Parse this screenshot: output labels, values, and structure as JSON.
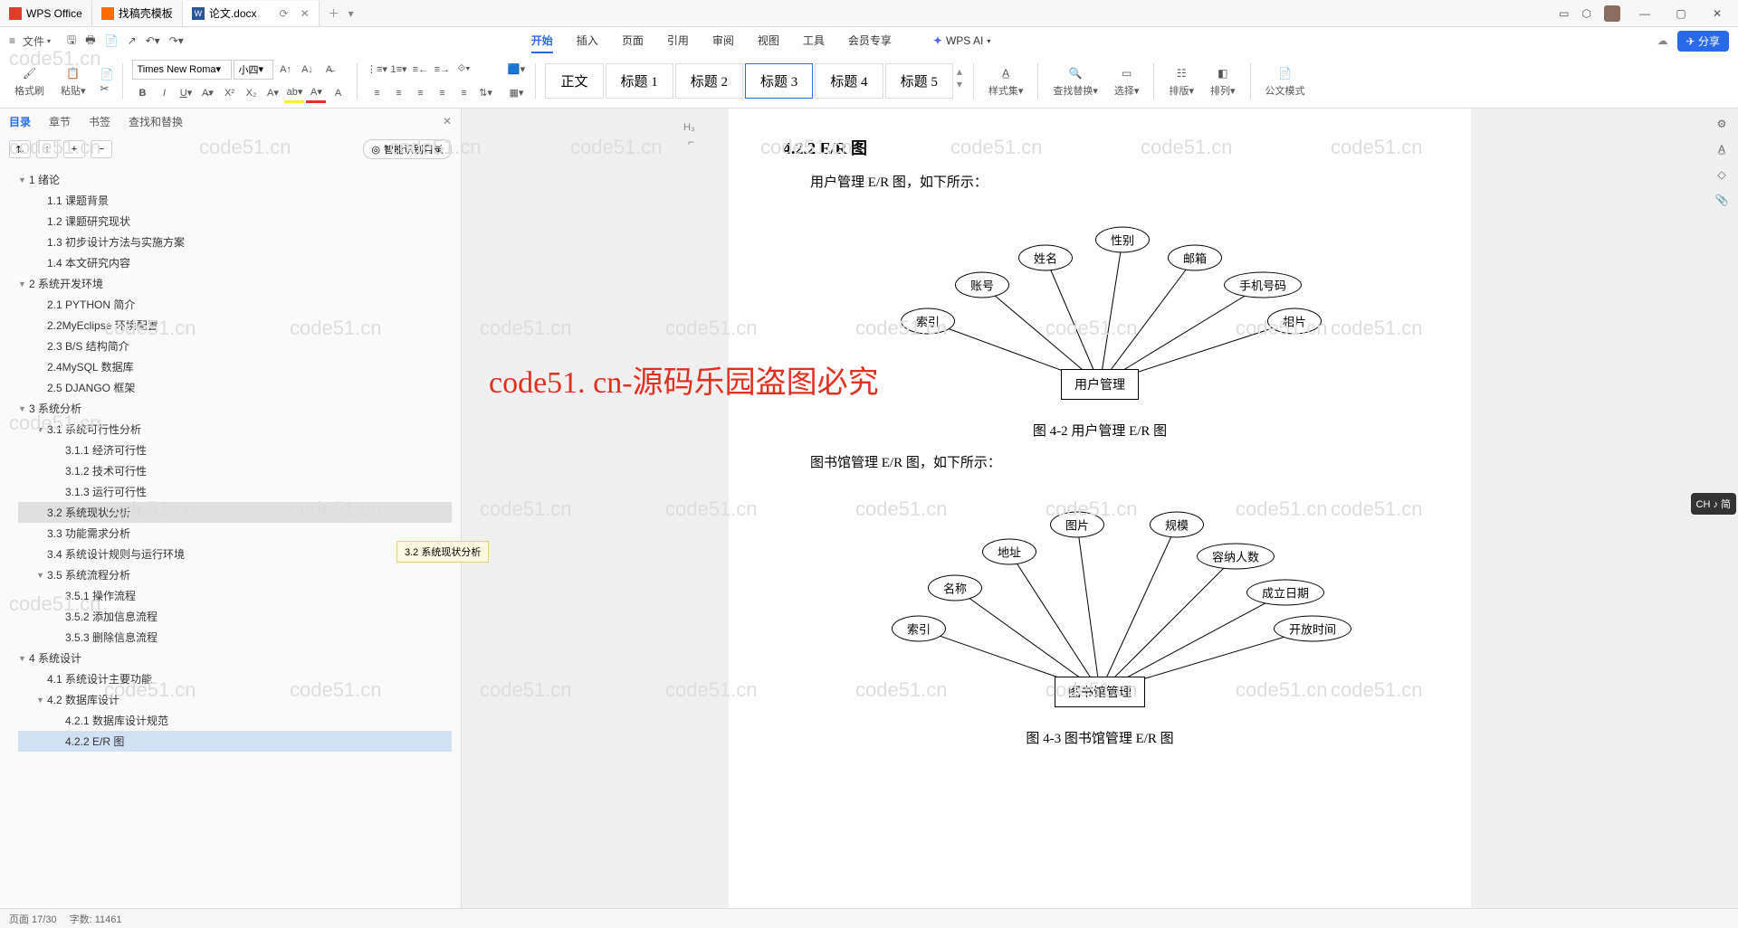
{
  "tabs": [
    {
      "icon": "W",
      "label": "WPS Office"
    },
    {
      "icon": "D",
      "label": "找稿壳模板"
    },
    {
      "icon": "W",
      "label": "论文.docx"
    }
  ],
  "menubar": {
    "file": "文件",
    "items": [
      "开始",
      "插入",
      "页面",
      "引用",
      "审阅",
      "视图",
      "工具",
      "会员专享"
    ],
    "active": "开始",
    "ai": "WPS AI",
    "share": "分享"
  },
  "ribbon": {
    "format_painter": "格式刷",
    "paste": "粘贴",
    "font_name": "Times New Roma",
    "font_size": "小四",
    "styles": [
      "正文",
      "标题 1",
      "标题 2",
      "标题 3",
      "标题 4",
      "标题 5"
    ],
    "style_active": "标题 3",
    "styleset": "样式集",
    "find_replace": "查找替换",
    "select": "选择",
    "layout_v": "排版",
    "layout_h": "排列",
    "gov_mode": "公文模式"
  },
  "sidebar": {
    "tabs": [
      "目录",
      "章节",
      "书签",
      "查找和替换"
    ],
    "active": "目录",
    "smart_toc": "智能识别目录",
    "tooltip": "3.2 系统现状分析",
    "toc": [
      {
        "l": 1,
        "t": "1 绪论",
        "c": true
      },
      {
        "l": 2,
        "t": "1.1 课题背景"
      },
      {
        "l": 2,
        "t": "1.2 课题研究现状"
      },
      {
        "l": 2,
        "t": "1.3 初步设计方法与实施方案"
      },
      {
        "l": 2,
        "t": "1.4 本文研究内容"
      },
      {
        "l": 1,
        "t": "2 系统开发环境",
        "c": true
      },
      {
        "l": 2,
        "t": "2.1 PYTHON 简介"
      },
      {
        "l": 2,
        "t": "2.2MyEclipse 环境配置"
      },
      {
        "l": 2,
        "t": "2.3 B/S 结构简介"
      },
      {
        "l": 2,
        "t": "2.4MySQL 数据库"
      },
      {
        "l": 2,
        "t": "2.5 DJANGO 框架"
      },
      {
        "l": 1,
        "t": "3 系统分析",
        "c": true
      },
      {
        "l": 2,
        "t": "3.1 系统可行性分析",
        "c": true
      },
      {
        "l": 3,
        "t": "3.1.1 经济可行性"
      },
      {
        "l": 3,
        "t": "3.1.2 技术可行性"
      },
      {
        "l": 3,
        "t": "3.1.3 运行可行性"
      },
      {
        "l": 2,
        "t": "3.2 系统现状分析",
        "sel": true
      },
      {
        "l": 2,
        "t": "3.3 功能需求分析"
      },
      {
        "l": 2,
        "t": "3.4 系统设计规则与运行环境"
      },
      {
        "l": 2,
        "t": "3.5 系统流程分析",
        "c": true
      },
      {
        "l": 3,
        "t": "3.5.1 操作流程"
      },
      {
        "l": 3,
        "t": "3.5.2 添加信息流程"
      },
      {
        "l": 3,
        "t": "3.5.3 删除信息流程"
      },
      {
        "l": 1,
        "t": "4 系统设计",
        "c": true
      },
      {
        "l": 2,
        "t": "4.1 系统设计主要功能"
      },
      {
        "l": 2,
        "t": "4.2 数据库设计",
        "c": true
      },
      {
        "l": 3,
        "t": "4.2.1 数据库设计规范"
      },
      {
        "l": 3,
        "t": "4.2.2 E/R 图",
        "cur": true
      }
    ]
  },
  "document": {
    "marker": "H₃",
    "section_heading": "4.2.2 E/R 图",
    "intro1": "用户管理 E/R 图，如下所示：",
    "er1": {
      "entity": "用户管理",
      "attrs": [
        "索引",
        "账号",
        "姓名",
        "性别",
        "邮箱",
        "手机号码",
        "相片"
      ]
    },
    "caption1": "图 4-2 用户管理 E/R 图",
    "intro2": "图书馆管理 E/R 图，如下所示：",
    "er2": {
      "entity": "图书馆管理",
      "attrs": [
        "索引",
        "名称",
        "地址",
        "图片",
        "规模",
        "容纳人数",
        "成立日期",
        "开放时间"
      ]
    },
    "caption2": "图 4-3 图书馆管理 E/R 图"
  },
  "watermark_text": "code51.cn",
  "big_watermark": "code51. cn-源码乐园盗图必究",
  "lang_badge": "CH ♪ 简",
  "statusbar": {
    "page": "页面 17/30",
    "words": "字数: 11461"
  },
  "chart_data": [
    {
      "type": "diagram",
      "title": "图 4-2 用户管理 E/R 图",
      "entity": "用户管理",
      "attributes": [
        "索引",
        "账号",
        "姓名",
        "性别",
        "邮箱",
        "手机号码",
        "相片"
      ]
    },
    {
      "type": "diagram",
      "title": "图 4-3 图书馆管理 E/R 图",
      "entity": "图书馆管理",
      "attributes": [
        "索引",
        "名称",
        "地址",
        "图片",
        "规模",
        "容纳人数",
        "成立日期",
        "开放时间"
      ]
    }
  ]
}
